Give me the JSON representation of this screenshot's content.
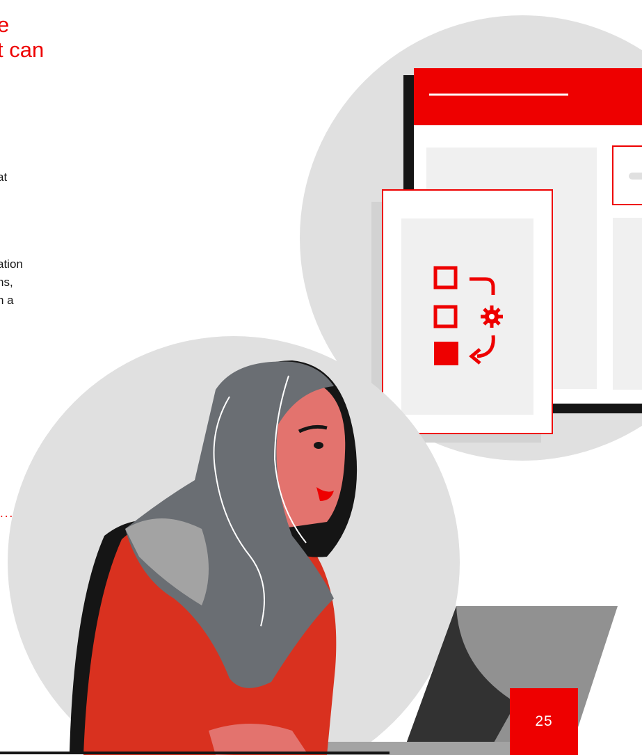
{
  "heading": {
    "lines": [
      "e",
      "t can"
    ]
  },
  "paragraphs": [
    {
      "lines": [
        "at"
      ]
    },
    {
      "lines": [
        "ation",
        "ns,",
        "n a"
      ]
    }
  ],
  "continuation_dots": "...",
  "page_number": "25",
  "colors": {
    "accent": "#ee0000",
    "gray_circle": "#e0e0e0",
    "panel": "#f0f0f0"
  }
}
